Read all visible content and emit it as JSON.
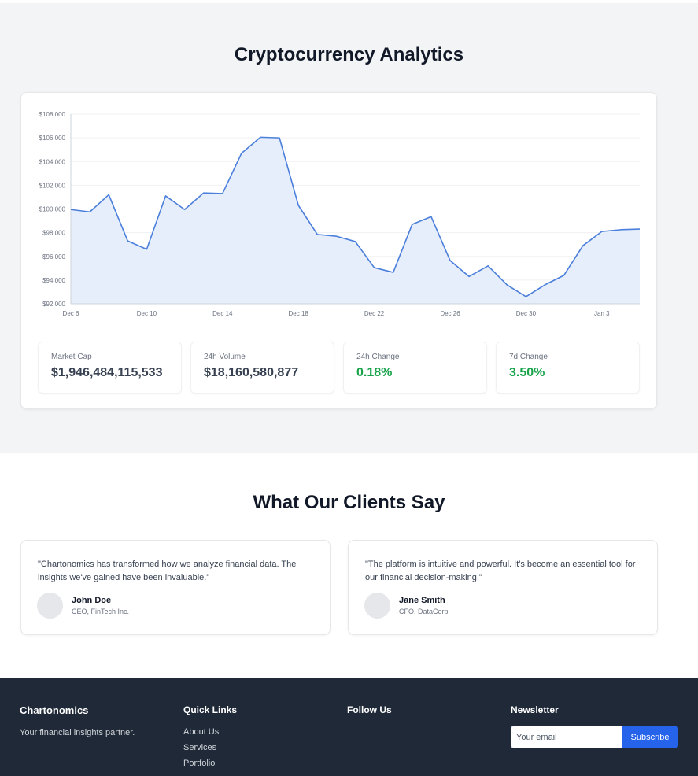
{
  "analytics": {
    "title": "Cryptocurrency Analytics",
    "stats": [
      {
        "label": "Market Cap",
        "value": "$1,946,484,115,533"
      },
      {
        "label": "24h Volume",
        "value": "$18,160,580,877"
      },
      {
        "label": "24h Change",
        "value": "0.18%"
      },
      {
        "label": "7d Change",
        "value": "3.50%"
      }
    ]
  },
  "chart_data": {
    "type": "area",
    "title": "",
    "xlabel": "",
    "ylabel": "",
    "x_ticks": [
      "Dec 6",
      "Dec 10",
      "Dec 14",
      "Dec 18",
      "Dec 22",
      "Dec 26",
      "Dec 30",
      "Jan 3"
    ],
    "y_ticks": [
      "$92,000",
      "$94,000",
      "$96,000",
      "$98,000",
      "$100,000",
      "$102,000",
      "$104,000",
      "$106,000",
      "$108,000"
    ],
    "ylim": [
      92000,
      108000
    ],
    "x": [
      "Dec 6",
      "Dec 7",
      "Dec 8",
      "Dec 9",
      "Dec 10",
      "Dec 11",
      "Dec 12",
      "Dec 13",
      "Dec 14",
      "Dec 15",
      "Dec 16",
      "Dec 17",
      "Dec 18",
      "Dec 19",
      "Dec 20",
      "Dec 21",
      "Dec 22",
      "Dec 23",
      "Dec 24",
      "Dec 25",
      "Dec 26",
      "Dec 27",
      "Dec 28",
      "Dec 29",
      "Dec 30",
      "Dec 31",
      "Jan 1",
      "Jan 2",
      "Jan 3",
      "Jan 4",
      "Jan 5"
    ],
    "values": [
      99950,
      99750,
      101200,
      97300,
      96600,
      101100,
      99950,
      101350,
      101300,
      104700,
      106050,
      106000,
      100300,
      97850,
      97700,
      97250,
      95050,
      94650,
      98700,
      99350,
      95650,
      94300,
      95200,
      93600,
      92600,
      93600,
      94400,
      96900,
      98100,
      98250,
      98300
    ],
    "colors": {
      "line": "#4a7fdb",
      "fill": "#e6edfb",
      "grid": "#f0f1f3",
      "axis": "#cfd4da"
    },
    "grid": true
  },
  "testimonials": {
    "title": "What Our Clients Say",
    "items": [
      {
        "quote": "\"Chartonomics has transformed how we analyze financial data. The insights we've gained have been invaluable.\"",
        "name": "John Doe",
        "role": "CEO, FinTech Inc."
      },
      {
        "quote": "\"The platform is intuitive and powerful. It's become an essential tool for our financial decision-making.\"",
        "name": "Jane Smith",
        "role": "CFO, DataCorp"
      }
    ]
  },
  "footer": {
    "brand": {
      "title": "Chartonomics",
      "tagline": "Your financial insights partner."
    },
    "quick_links": {
      "title": "Quick Links",
      "links": [
        "About Us",
        "Services",
        "Portfolio"
      ]
    },
    "follow": {
      "title": "Follow Us"
    },
    "newsletter": {
      "title": "Newsletter",
      "placeholder": "Your email",
      "button": "Subscribe"
    }
  },
  "colors": {
    "accent": "#2563eb",
    "positive": "#16a34a",
    "footer_bg": "#1f2937",
    "section_bg": "#f3f4f6"
  }
}
